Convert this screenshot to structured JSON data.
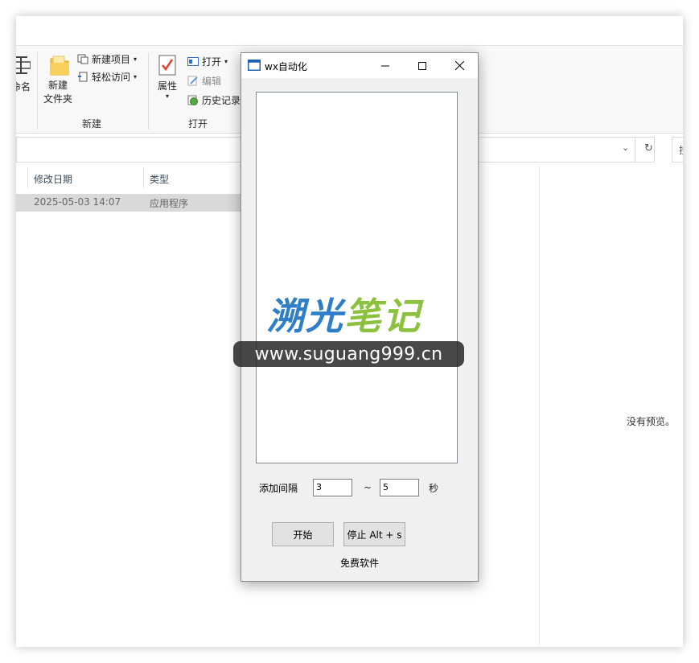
{
  "explorer": {
    "ribbon": {
      "partial_label": "命名",
      "new_folder_label_1": "新建",
      "new_folder_label_2": "文件夹",
      "new_item": "新建项目",
      "easy_access": "轻松访问",
      "group_new": "新建",
      "properties": "属性",
      "open": "打开",
      "edit": "编辑",
      "history": "历史记录",
      "group_open": "打开"
    },
    "columns": {
      "date_modified": "修改日期",
      "type": "类型"
    },
    "file_row": {
      "date": "2025-05-03 14:07",
      "type": "应用程序"
    },
    "preview_text": "没有预览。",
    "search_edge": "搜"
  },
  "dialog": {
    "title": "wx自动化",
    "interval_label": "添加间隔",
    "interval_min": "3",
    "tilde": "~",
    "interval_max": "5",
    "seconds_label": "秒",
    "start_button": "开始",
    "stop_button": "停止 Alt + s",
    "footer": "免费软件"
  },
  "watermark": {
    "logo_blue": "溯光",
    "logo_green": "笔记",
    "url": "www.suguang999.cn"
  },
  "colors": {
    "accent_blue": "#2f7fc8",
    "accent_green": "#8cc13f",
    "selected_row": "#d9d9d9"
  }
}
